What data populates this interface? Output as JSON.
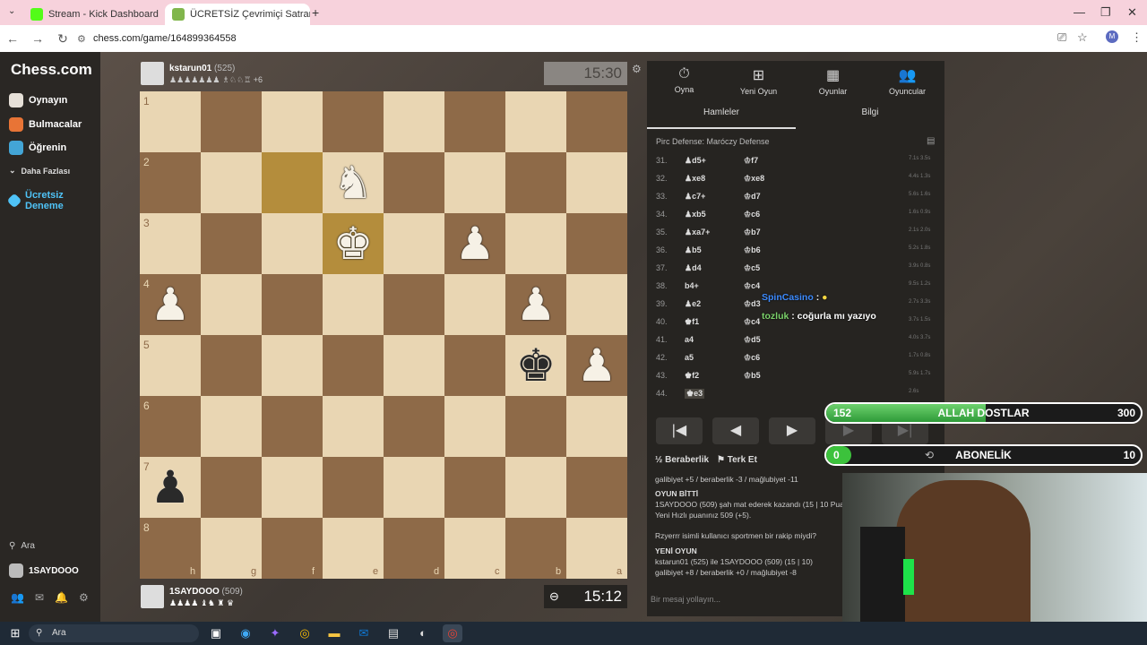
{
  "browser": {
    "tabs": [
      {
        "label": "Stream - Kick Dashboard"
      },
      {
        "label": "ÜCRETSİZ Çevrimiçi Satranç Oy"
      }
    ],
    "url": "chess.com/game/164899364558",
    "profile_initial": "M"
  },
  "sidebar": {
    "logo": "Chess.com",
    "items": [
      {
        "label": "Oynayın"
      },
      {
        "label": "Bulmacalar"
      },
      {
        "label": "Öğrenin"
      },
      {
        "label": "Daha Fazlası"
      }
    ],
    "trial": "Ücretsiz Deneme",
    "search": "Ara",
    "username": "1SAYDOOO"
  },
  "top_player": {
    "name": "kstarun01",
    "rating": "(525)",
    "captured": "+6",
    "clock": "15:30"
  },
  "bottom_player": {
    "name": "1SAYDOOO",
    "rating": "(509)",
    "clock": "15:12"
  },
  "board": {
    "ranks": [
      "1",
      "2",
      "3",
      "4",
      "5",
      "6",
      "7",
      "8"
    ],
    "files": [
      "h",
      "g",
      "f",
      "e",
      "d",
      "c",
      "b",
      "a"
    ],
    "highlight": [
      [
        1,
        2
      ],
      [
        2,
        3
      ]
    ],
    "pieces": [
      {
        "row": 1,
        "col": 3,
        "glyph": "♞",
        "color": "w"
      },
      {
        "row": 2,
        "col": 3,
        "glyph": "♚",
        "color": "w"
      },
      {
        "row": 2,
        "col": 5,
        "glyph": "♟",
        "color": "w"
      },
      {
        "row": 3,
        "col": 0,
        "glyph": "♟",
        "color": "w"
      },
      {
        "row": 3,
        "col": 6,
        "glyph": "♟",
        "color": "w"
      },
      {
        "row": 4,
        "col": 6,
        "glyph": "♚",
        "color": "b"
      },
      {
        "row": 4,
        "col": 7,
        "glyph": "♟",
        "color": "w"
      },
      {
        "row": 6,
        "col": 0,
        "glyph": "♟",
        "color": "b"
      }
    ]
  },
  "panel": {
    "tabs": [
      {
        "label": "Oyna",
        "icon": "⏱"
      },
      {
        "label": "Yeni Oyun",
        "icon": "⊞"
      },
      {
        "label": "Oyunlar",
        "icon": "▦"
      },
      {
        "label": "Oyuncular",
        "icon": "👥"
      }
    ],
    "subtabs": [
      {
        "label": "Hamleler"
      },
      {
        "label": "Bilgi"
      }
    ],
    "opening": "Pirc Defense: Maróczy Defense",
    "moves": [
      {
        "n": "31.",
        "w": "♟d5+",
        "b": "♔f7",
        "t": "7.1s 3.5s"
      },
      {
        "n": "32.",
        "w": "♟xe8",
        "b": "♔xe8",
        "t": "4.4s 1.3s"
      },
      {
        "n": "33.",
        "w": "♟c7+",
        "b": "♔d7",
        "t": "5.6s 1.6s"
      },
      {
        "n": "34.",
        "w": "♟xb5",
        "b": "♔c6",
        "t": "1.6s 0.9s"
      },
      {
        "n": "35.",
        "w": "♟xa7+",
        "b": "♔b7",
        "t": "2.1s 2.0s"
      },
      {
        "n": "36.",
        "w": "♟b5",
        "b": "♔b6",
        "t": "5.2s 1.8s"
      },
      {
        "n": "37.",
        "w": "♟d4",
        "b": "♔c5",
        "t": "3.9s 0.8s"
      },
      {
        "n": "38.",
        "w": "b4+",
        "b": "♔c4",
        "t": "9.5s 1.2s"
      },
      {
        "n": "39.",
        "w": "♟e2",
        "b": "♔d3",
        "t": "2.7s 3.3s"
      },
      {
        "n": "40.",
        "w": "♚f1",
        "b": "♔c4",
        "t": "3.7s 1.5s"
      },
      {
        "n": "41.",
        "w": "a4",
        "b": "♔d5",
        "t": "4.0s 3.7s"
      },
      {
        "n": "42.",
        "w": "a5",
        "b": "♔c6",
        "t": "1.7s 0.8s"
      },
      {
        "n": "43.",
        "w": "♚f2",
        "b": "♔b5",
        "t": "5.9s 1.7s"
      },
      {
        "n": "44.",
        "w": "♚e3",
        "b": "",
        "t": "2.6s"
      }
    ],
    "nav": [
      "|◀",
      "◀",
      "▶",
      "▶",
      "▶|"
    ],
    "draw": "Beraberlik",
    "resign": "Terk Et",
    "chat": [
      "galibiyet +5 / beraberlik -3 / mağlubiyet -11",
      "OYUN BİTTİ",
      "1SAYDOOO (509) şah mat ederek kazandı (15 | 10 Pua",
      "Yeni Hızlı puanınız 509 (+5).",
      "Rzyerrr isimli kullanıcı sportmen bir rakip miydi?",
      "YENİ OYUN",
      "kstarun01 (525) ile 1SAYDOOO (509) (15 | 10)",
      "galibiyet +8 / beraberlik +0 / mağlubiyet -8"
    ],
    "message_placeholder": "Bir mesaj yollayın..."
  },
  "overlay": {
    "chat": [
      {
        "user": "SpinCasino",
        "text": ":"
      },
      {
        "user": "tozluk",
        "text": ": coğurla mı yazıyo"
      }
    ],
    "goal1": {
      "current": "152",
      "label": "ALLAH DOSTLAR",
      "target": "300",
      "fraction": 0.507
    },
    "goal2": {
      "current": "0",
      "label": "ABONELİK",
      "target": "10",
      "fraction": 0.0
    }
  },
  "taskbar": {
    "search": "Ara"
  }
}
